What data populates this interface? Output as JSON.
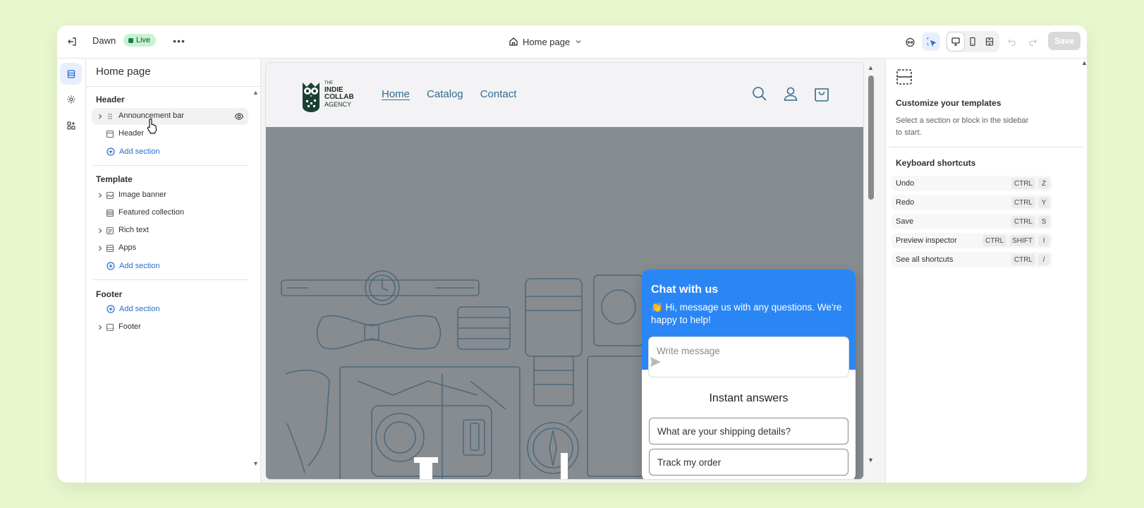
{
  "topbar": {
    "theme_name": "Dawn",
    "live_badge": "Live",
    "more_label": "•••",
    "page_selector": "Home page",
    "save_label": "Save"
  },
  "sidebar": {
    "title": "Home page",
    "groups": [
      {
        "title": "Header",
        "items": [
          {
            "label": "Announcement bar",
            "icon": "drag-handle-icon"
          },
          {
            "label": "Header",
            "icon": "header-layout-icon"
          }
        ],
        "add_label": "Add section"
      },
      {
        "title": "Template",
        "items": [
          {
            "label": "Image banner",
            "icon": "image-icon"
          },
          {
            "label": "Featured collection",
            "icon": "collection-icon"
          },
          {
            "label": "Rich text",
            "icon": "text-block-icon"
          },
          {
            "label": "Apps",
            "icon": "apps-icon"
          }
        ],
        "add_label": "Add section"
      },
      {
        "title": "Footer",
        "items": [
          {
            "label": "Footer",
            "icon": "footer-layout-icon"
          }
        ],
        "add_label": "Add section"
      }
    ]
  },
  "preview": {
    "logo": {
      "line_small": "THE",
      "line1": "INDIE",
      "line2": "COLLAB",
      "line3": "AGENCY"
    },
    "nav": [
      "Home",
      "Catalog",
      "Contact"
    ],
    "chat": {
      "title": "Chat with us",
      "subtitle": "👏 Hi, message us with any questions. We're happy to help!",
      "placeholder": "Write message",
      "instant_title": "Instant answers",
      "questions": [
        "What are your shipping details?",
        "Track my order"
      ]
    }
  },
  "rightpanel": {
    "title": "Customize your templates",
    "description": "Select a section or block in the sidebar to start.",
    "shortcuts_title": "Keyboard shortcuts",
    "shortcuts": [
      {
        "label": "Undo",
        "keys": [
          "CTRL",
          "Z"
        ]
      },
      {
        "label": "Redo",
        "keys": [
          "CTRL",
          "Y"
        ]
      },
      {
        "label": "Save",
        "keys": [
          "CTRL",
          "S"
        ]
      },
      {
        "label": "Preview inspector",
        "keys": [
          "CTRL",
          "SHIFT",
          "I"
        ]
      },
      {
        "label": "See all shortcuts",
        "keys": [
          "CTRL",
          "/"
        ]
      }
    ]
  },
  "colors": {
    "background": "#e8f7cd",
    "accent": "#2c6ecb",
    "chat_blue": "#2b86f5",
    "live_badge": "#c7f3d3",
    "nav_link": "#2e6c8f",
    "hero_gray": "#878c91"
  }
}
